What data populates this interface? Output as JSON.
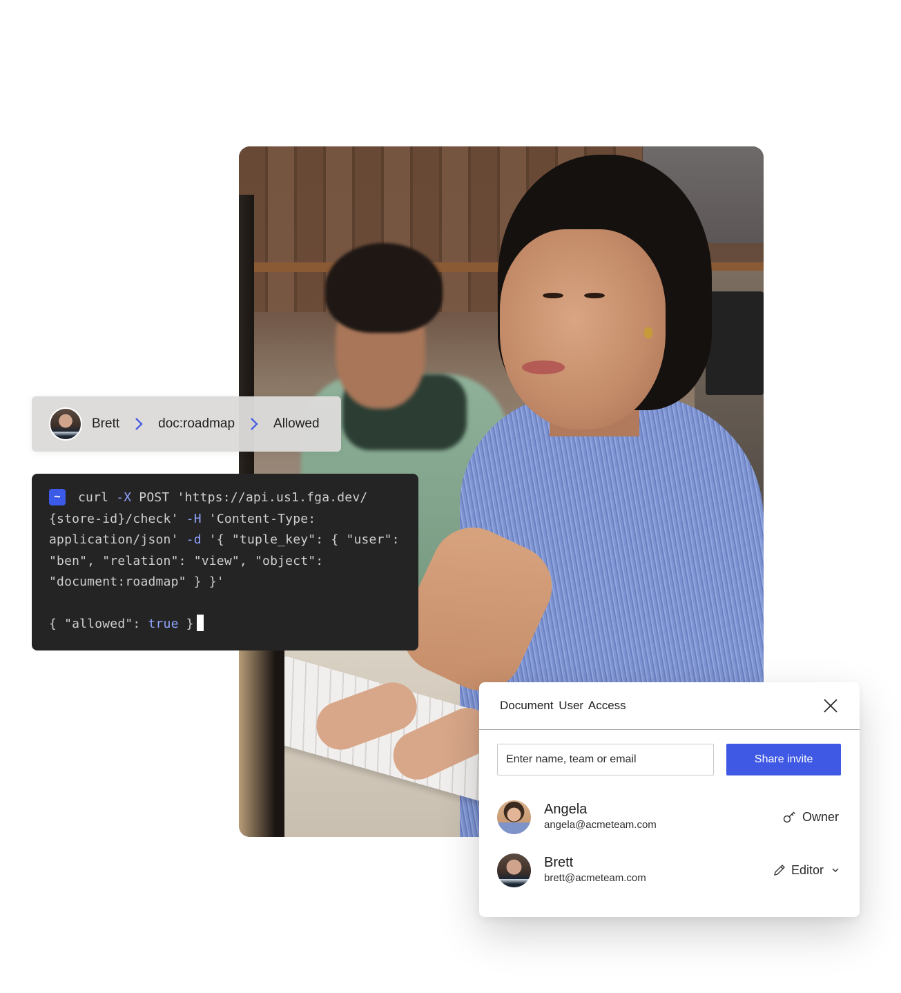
{
  "breadcrumb": {
    "items": [
      {
        "label": "Brett",
        "avatar": "brett-avatar"
      },
      {
        "label": "doc:roadmap"
      },
      {
        "label": "Allowed"
      }
    ],
    "separator_icon": "chevron-right-icon",
    "accent": "#4a5fe0"
  },
  "terminal": {
    "prompt_icon": "~",
    "lines": [
      [
        {
          "t": "curl ",
          "c": ""
        },
        {
          "t": "-X",
          "c": "flag"
        },
        {
          "t": " POST 'https://api.us1.fga.dev/",
          "c": ""
        }
      ],
      [
        {
          "t": "{store-id}/check' ",
          "c": ""
        },
        {
          "t": "-H",
          "c": "flag"
        },
        {
          "t": " 'Content-Type:",
          "c": ""
        }
      ],
      [
        {
          "t": "application/json' ",
          "c": ""
        },
        {
          "t": "-d",
          "c": "flag"
        },
        {
          "t": " '{ \"tuple_key\": { \"user\":",
          "c": ""
        }
      ],
      [
        {
          "t": "\"ben\", \"relation\": \"view\", \"object\":",
          "c": ""
        }
      ],
      [
        {
          "t": "\"document:roadmap\" } }'",
          "c": ""
        }
      ],
      [],
      [
        {
          "t": "{ \"allowed\": ",
          "c": ""
        },
        {
          "t": "true",
          "c": "kw"
        },
        {
          "t": " }",
          "c": ""
        }
      ]
    ],
    "background": "#242424",
    "accent": "#8fa3ff"
  },
  "dialog": {
    "title": "Document  User  Access",
    "close_icon": "close-icon",
    "input": {
      "value": "",
      "placeholder": "Enter name, team or email"
    },
    "share_button": "Share invite",
    "accent": "#3f59e4",
    "users": [
      {
        "name": "Angela",
        "email": "angela@acmeteam.com",
        "role": "Owner",
        "role_icon": "key-icon",
        "dropdown": false
      },
      {
        "name": "Brett",
        "email": "brett@acmeteam.com",
        "role": "Editor",
        "role_icon": "pencil-icon",
        "dropdown": true
      }
    ]
  },
  "photo": {
    "description": "Woman in blue ribbed top typing on a white keyboard, man in green shirt in background"
  }
}
